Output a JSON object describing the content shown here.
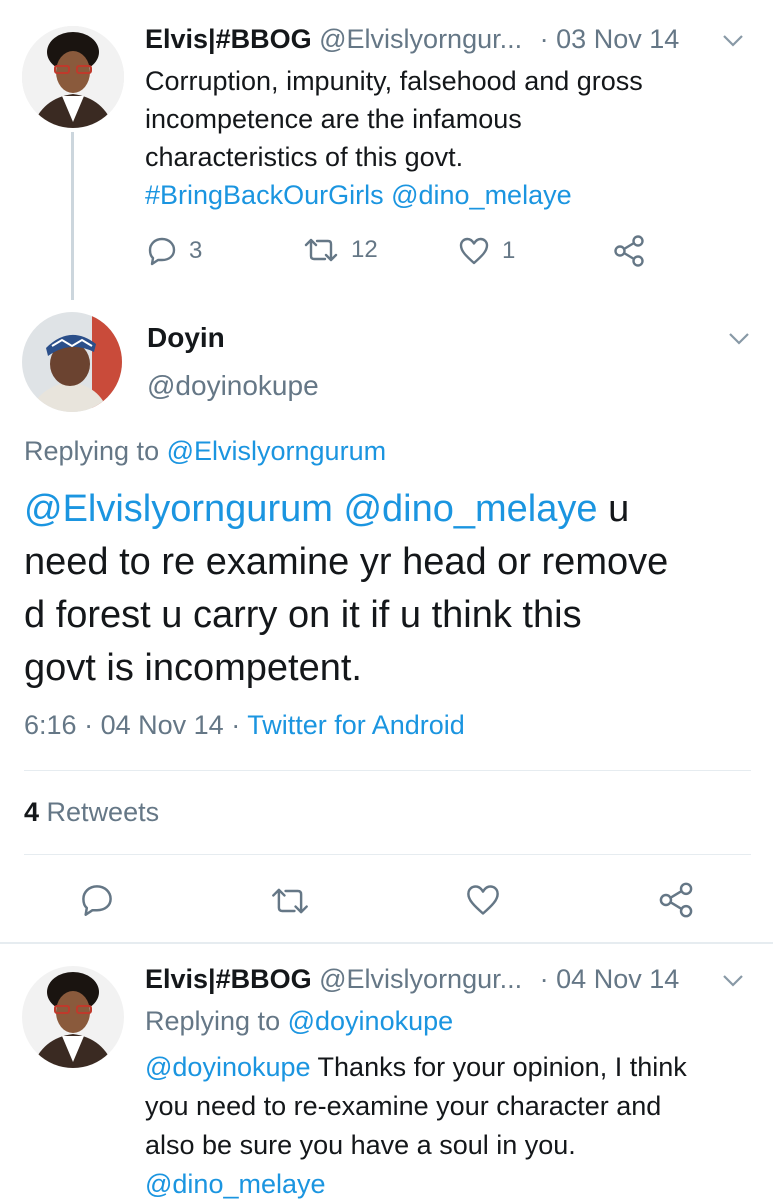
{
  "tweet1": {
    "name": "Elvis|#BBOG",
    "handle": "@Elvislyorngur...",
    "dot": "·",
    "date": "03 Nov 14",
    "text_line1": "Corruption, impunity, falsehood and gross",
    "text_line2": "incompetence are the infamous",
    "text_line3": "characteristics of this govt.",
    "hashtag": "#BringBackOurGirls",
    "mention": "@dino_melaye",
    "replies": "3",
    "retweets": "12",
    "likes": "1"
  },
  "main_tweet": {
    "name": "Doyin",
    "handle": "@doyinokupe",
    "replying_label": "Replying to",
    "replying_to": "@Elvislyorngurum",
    "mention1": "@Elvislyorngurum",
    "mention2": "@dino_melaye",
    "text_after_mentions": "u",
    "text_line2": "need to re examine yr head or remove",
    "text_line3": "d forest u carry on it if u think this",
    "text_line4": "govt is incompetent.",
    "time": "6:16",
    "date": "04 Nov 14",
    "source": "Twitter for Android",
    "sep1": "·",
    "sep2": "·",
    "retweet_count": "4",
    "retweet_label": "Retweets"
  },
  "tweet3": {
    "name": "Elvis|#BBOG",
    "handle": "@Elvislyorngur...",
    "dot": "·",
    "date": "04 Nov 14",
    "replying_label": "Replying to",
    "replying_to": "@doyinokupe",
    "mention": "@doyinokupe",
    "text_line1_rest": "Thanks for your opinion, I think",
    "text_line2": "you need to re-examine your character and",
    "text_line3": "also be sure you have a soul in you.",
    "mention2": "@dino_melaye"
  },
  "colors": {
    "link": "#1b95e0",
    "muted": "#657786",
    "text": "#14171a",
    "divider": "#e6ecf0"
  },
  "icons": [
    "reply-icon",
    "retweet-icon",
    "like-icon",
    "share-icon",
    "chevron-down-icon"
  ]
}
